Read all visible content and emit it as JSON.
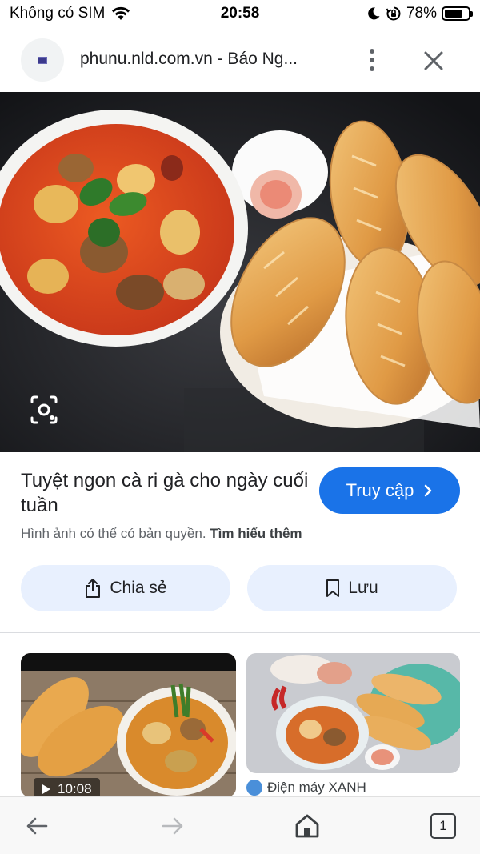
{
  "status_bar": {
    "carrier": "Không có SIM",
    "time": "20:58",
    "battery": "78%",
    "battery_level": 0.78,
    "icons": [
      "wifi-icon",
      "moon-icon",
      "orientation-lock-icon",
      "battery-icon"
    ]
  },
  "header": {
    "source_title": "phunu.nld.com.vn - Báo Ng...",
    "icons": [
      "site-favicon",
      "more-vert-icon",
      "close-icon"
    ]
  },
  "image_panel": {
    "title": "Tuyệt ngon cà ri gà cho ngày cuối tuần",
    "visit_label": "Truy cập",
    "copyright_text": "Hình ảnh có thể có bản quyền.",
    "learn_more": "Tìm hiểu thêm",
    "share_label": "Chia sẻ",
    "save_label": "Lưu",
    "icons": [
      "lens-icon",
      "chevron-right-icon",
      "share-icon",
      "bookmark-icon"
    ]
  },
  "related": [
    {
      "duration": "10:08",
      "icon": "play-icon"
    },
    {
      "source": "Điện máy XANH",
      "icon": "source-favicon"
    }
  ],
  "toolbar": {
    "tab_count": "1",
    "icons": [
      "back-icon",
      "forward-icon",
      "home-icon",
      "tabs-icon"
    ]
  },
  "colors": {
    "accent": "#1a73e8",
    "chip_bg": "#e8f0fe",
    "text": "#202124",
    "muted": "#5f6368"
  }
}
